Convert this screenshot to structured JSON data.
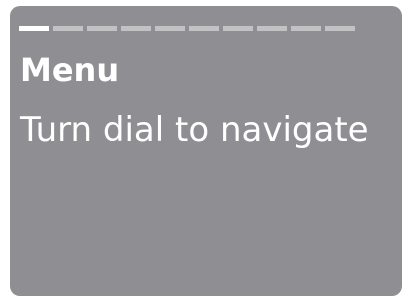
{
  "screen": {
    "progress": {
      "total_steps": 10,
      "current_step": 1
    },
    "title": "Menu",
    "message": "Turn dial to navigate"
  },
  "colors": {
    "screen_background": "#8f8f93",
    "text": "#ffffff",
    "segment_active": "#ffffff",
    "segment_inactive": "#c2c2c4"
  }
}
